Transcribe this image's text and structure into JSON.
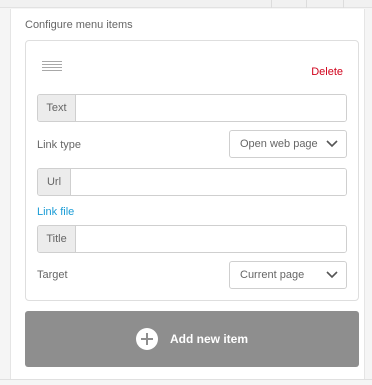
{
  "section": {
    "title": "Configure menu items"
  },
  "item": {
    "delete_label": "Delete",
    "text": {
      "addon": "Text",
      "value": ""
    },
    "link_type": {
      "label": "Link type",
      "selected": "Open web page"
    },
    "url": {
      "addon": "Url",
      "value": ""
    },
    "link_file_label": "Link file",
    "title": {
      "addon": "Title",
      "value": ""
    },
    "target": {
      "label": "Target",
      "selected": "Current page"
    }
  },
  "add_button": {
    "label": "Add new item"
  },
  "colors": {
    "delete": "#d0021b",
    "link": "#1a9cd6",
    "add_button_bg": "#8e8e8e"
  },
  "icons": {
    "drag": "drag-handle-icon",
    "chevron": "chevron-down-icon",
    "add": "plus-circle-icon"
  }
}
